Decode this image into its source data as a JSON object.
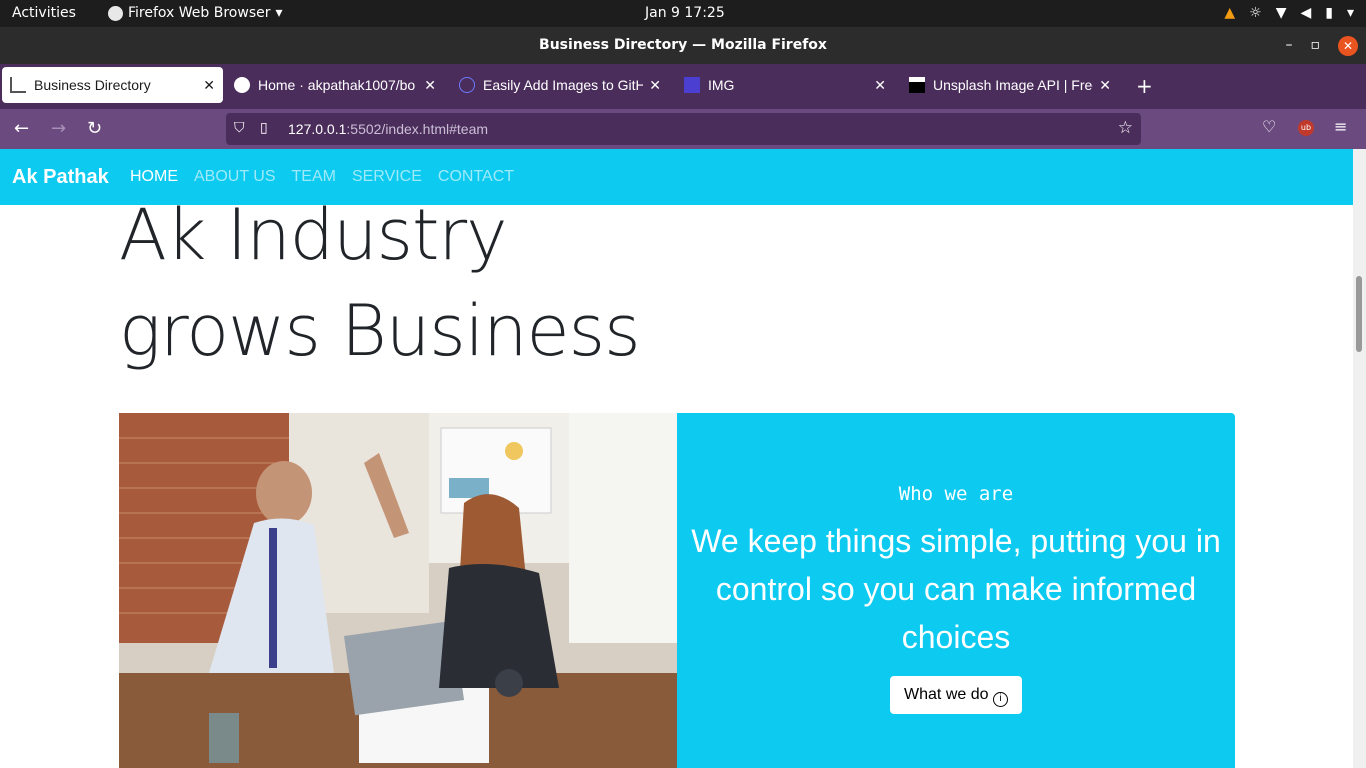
{
  "system": {
    "activities": "Activities",
    "app": "Firefox Web Browser",
    "clock": "Jan 9  17:25"
  },
  "window": {
    "title": "Business Directory — Mozilla Firefox"
  },
  "tabs": [
    {
      "label": "Business Directory",
      "active": true
    },
    {
      "label": "Home · akpathak1007/bo"
    },
    {
      "label": "Easily Add Images to GitH"
    },
    {
      "label": "IMG"
    },
    {
      "label": "Unsplash Image API | Free"
    }
  ],
  "url": {
    "host": "127.0.0.1",
    "rest": ":5502/index.html#team"
  },
  "site": {
    "brand": "Ak Pathak",
    "nav": [
      "HOME",
      "ABOUT US",
      "TEAM",
      "SERVICE",
      "CONTACT"
    ],
    "hero_line1": "Ak Industry",
    "hero_line2": "grows Business",
    "who": "Who we are",
    "lead": "We keep things simple, putting you in control so you can make informed choices",
    "button": "What we do",
    "accent": "#0dcaf0"
  }
}
